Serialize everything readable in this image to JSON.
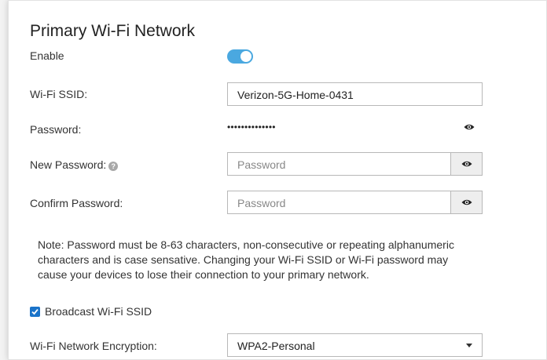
{
  "section": {
    "title": "Primary Wi-Fi Network"
  },
  "enable": {
    "label": "Enable",
    "on": true
  },
  "ssid": {
    "label": "Wi-Fi SSID:",
    "value": "Verizon-5G-Home-0431"
  },
  "password": {
    "label": "Password:",
    "masked_value": "••••••••••••••"
  },
  "new_password": {
    "label": "New Password:",
    "placeholder": "Password"
  },
  "confirm_password": {
    "label": "Confirm Password:",
    "placeholder": "Password"
  },
  "note": "Note: Password must be 8-63 characters, non-consecutive or repeating alphanumeric characters and is case sensative. Changing your Wi-Fi SSID or Wi-Fi password may cause your devices to lose their connection to your primary network.",
  "broadcast": {
    "label": "Broadcast Wi-Fi SSID",
    "checked": true
  },
  "encryption": {
    "label": "Wi-Fi Network Encryption:",
    "selected": "WPA2-Personal"
  },
  "colors": {
    "accent": "#4aa8e0",
    "checkbox": "#1a73c9"
  },
  "icons": {
    "eye": "eye-icon",
    "help": "question-circle-icon",
    "caret": "caret-down-icon"
  }
}
